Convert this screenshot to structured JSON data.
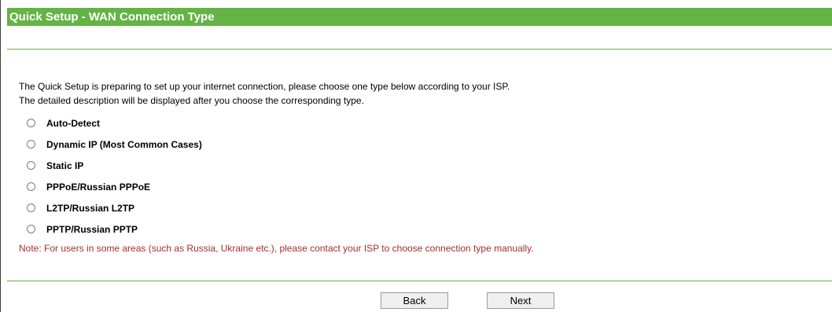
{
  "header": {
    "title": "Quick Setup - WAN Connection Type"
  },
  "main": {
    "description_line1": "The Quick Setup is preparing to set up your internet connection, please choose one type below according to your ISP.",
    "description_line2": "The detailed description will be displayed after you choose the corresponding type.",
    "options": [
      {
        "label": "Auto-Detect",
        "selected": false
      },
      {
        "label": "Dynamic IP (Most Common Cases)",
        "selected": false
      },
      {
        "label": "Static IP",
        "selected": false
      },
      {
        "label": "PPPoE/Russian PPPoE",
        "selected": false
      },
      {
        "label": "L2TP/Russian L2TP",
        "selected": false
      },
      {
        "label": "PPTP/Russian PPTP",
        "selected": false
      }
    ],
    "note": "Note: For users in some areas (such as Russia, Ukraine etc.), please contact your ISP to choose connection type manually."
  },
  "footer": {
    "back_label": "Back",
    "next_label": "Next"
  },
  "colors": {
    "accent": "#64b345",
    "note": "#a0302a"
  }
}
